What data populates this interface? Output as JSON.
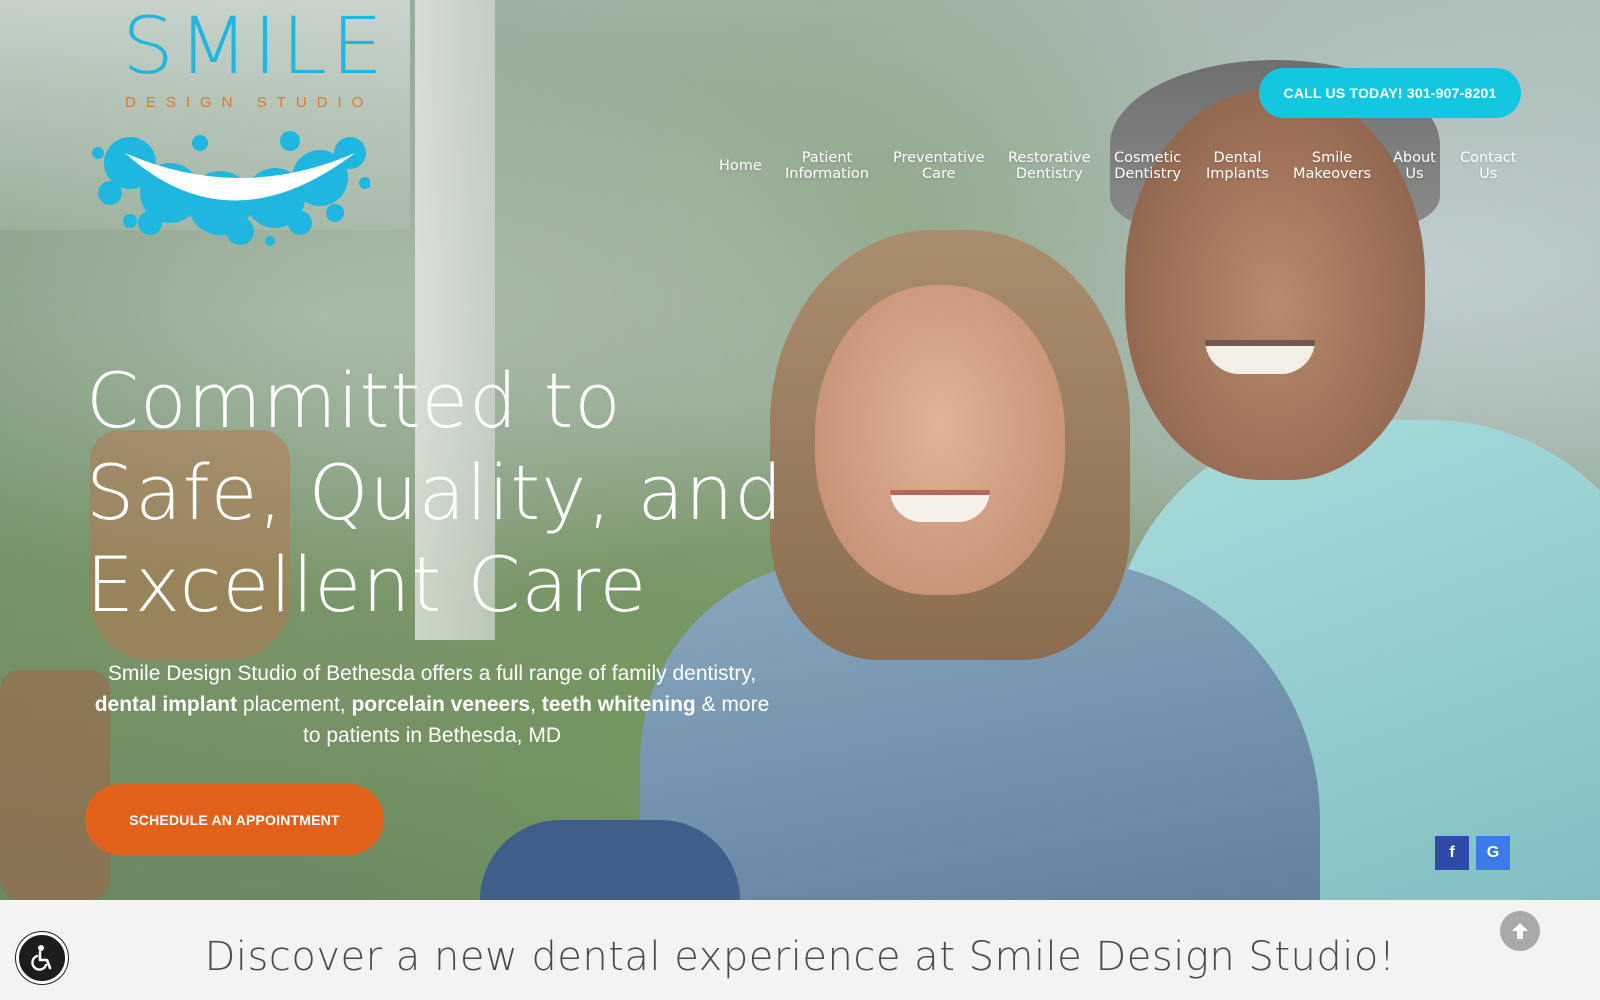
{
  "logo": {
    "word": "SMILE",
    "sub": "DESIGN STUDIO"
  },
  "header": {
    "call_label": "CALL US TODAY! 301-907-8201"
  },
  "nav": {
    "items": [
      {
        "label": "Home"
      },
      {
        "label": "Patient\nInformation"
      },
      {
        "label": "Preventative\nCare"
      },
      {
        "label": "Restorative\nDentistry"
      },
      {
        "label": "Cosmetic\nDentistry"
      },
      {
        "label": "Dental\nImplants"
      },
      {
        "label": "Smile\nMakeovers"
      },
      {
        "label": "About\nUs"
      },
      {
        "label": "Contact\nUs"
      }
    ]
  },
  "hero": {
    "headline_line1": "Committed to",
    "headline_line2": "Safe, Quality, and",
    "headline_line3": "Excellent Care",
    "sub_part1": "Smile Design Studio of Bethesda offers a full range of family dentistry, ",
    "sub_bold1": "dental implant",
    "sub_part2": " placement, ",
    "sub_bold2": "porcelain veneers",
    "sub_part3": ", ",
    "sub_bold3": "teeth whitening",
    "sub_part4": " & more to patients in Bethesda, MD",
    "cta_label": "SCHEDULE AN APPOINTMENT"
  },
  "social": {
    "facebook_icon": "facebook-icon",
    "google_icon": "google-icon",
    "facebook_glyph": "f",
    "google_glyph": "G"
  },
  "bottom": {
    "title": "Discover a new dental experience at Smile Design Studio!"
  },
  "colors": {
    "logo_blue": "#1fb7e0",
    "logo_orange": "#e07a2a",
    "call_button": "#12c7df",
    "cta_orange": "#e2621c",
    "facebook": "#2f4aa8",
    "google": "#3b7be8"
  }
}
